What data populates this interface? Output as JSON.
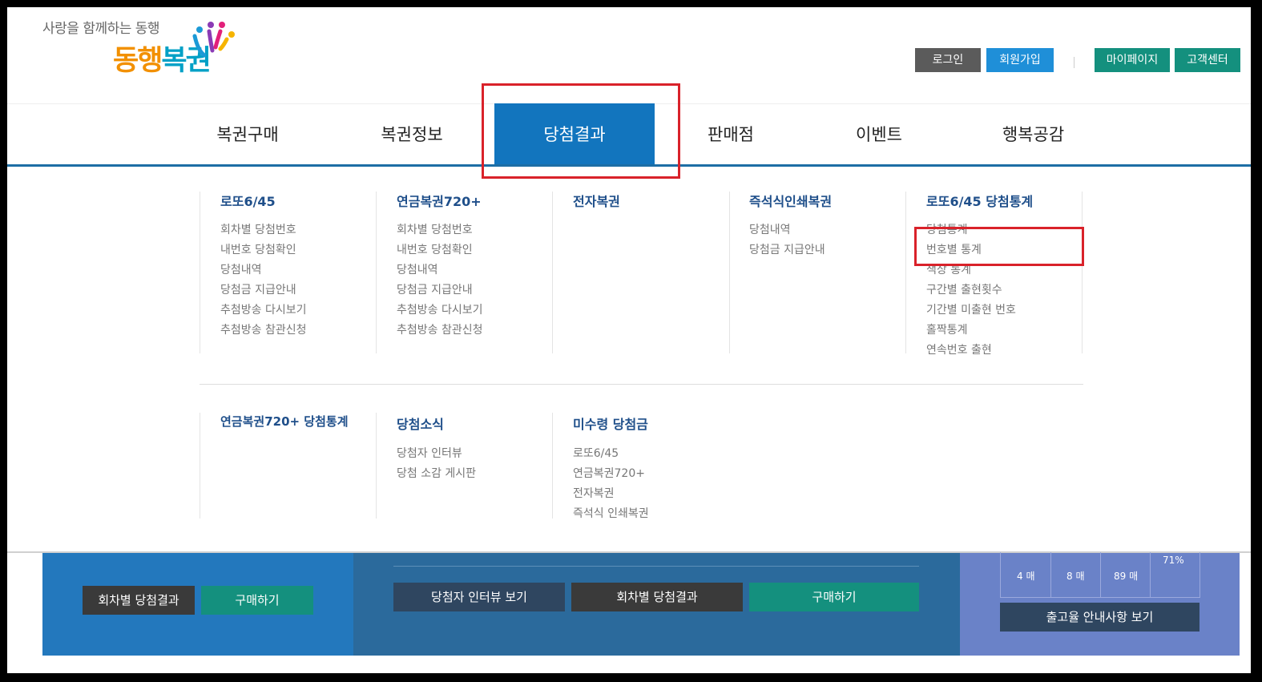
{
  "header": {
    "slogan": "사랑을 함께하는 동행",
    "brand_part1": "동행",
    "brand_part2": "복권",
    "buttons": {
      "login": "로그인",
      "signup": "회원가입",
      "mypage": "마이페이지",
      "support": "고객센터"
    },
    "colors": {
      "login": "#5b5b5b",
      "signup": "#1f8fd8",
      "mypage": "#14907e",
      "support": "#14907e"
    }
  },
  "gnb": {
    "items": [
      "복권구매",
      "복권정보",
      "당첨결과",
      "판매점",
      "이벤트",
      "행복공감"
    ],
    "active": "당첨결과",
    "active_color": "#1275be"
  },
  "menu": {
    "lotto645": {
      "title": "로또6/45",
      "links": [
        "회차별 당첨번호",
        "내번호 당첨확인",
        "당첨내역",
        "당첨금 지급안내",
        "추첨방송 다시보기",
        "추첨방송 참관신청"
      ]
    },
    "pension720": {
      "title": "연금복권720+",
      "links": [
        "회차별 당첨번호",
        "내번호 당첨확인",
        "당첨내역",
        "당첨금 지급안내",
        "추첨방송 다시보기",
        "추첨방송 참관신청"
      ]
    },
    "electronic": {
      "title": "전자복권",
      "links": []
    },
    "instant": {
      "title": "즉석식인쇄복권",
      "links": [
        "당첨내역",
        "당첨금 지급안내"
      ]
    },
    "lotto_stats": {
      "title": "로또6/45 당첨통계",
      "links": [
        "당첨통계",
        "번호별 통계",
        "색상 통계",
        "구간별 출현횟수",
        "기간별 미출현 번호",
        "홀짝통계",
        "연속번호 출현"
      ]
    },
    "pension_stats": {
      "title": "연금복권720+ 당첨통계",
      "links": []
    },
    "news": {
      "title": "당첨소식",
      "links": [
        "당첨자 인터뷰",
        "당첨 소감 게시판"
      ]
    },
    "unclaimed": {
      "title": "미수령 당첨금",
      "links": [
        "로또6/45",
        "연금복권720+",
        "전자복권",
        "즉석식 인쇄복권"
      ]
    }
  },
  "bottom": {
    "left": {
      "results": "회차별 당첨결과",
      "buy": "구매하기"
    },
    "middle": {
      "interview": "당첨자 인터뷰 보기",
      "results": "회차별 당첨결과",
      "buy": "구매하기"
    },
    "right": {
      "percent": "71%",
      "counts": [
        "4 매",
        "8 매",
        "89 매"
      ],
      "guide": "출고율 안내사항 보기"
    },
    "colors": {
      "left_panel": "#2378bd",
      "middle_panel": "#2b6a9c",
      "right_panel": "#6a82c8"
    }
  }
}
